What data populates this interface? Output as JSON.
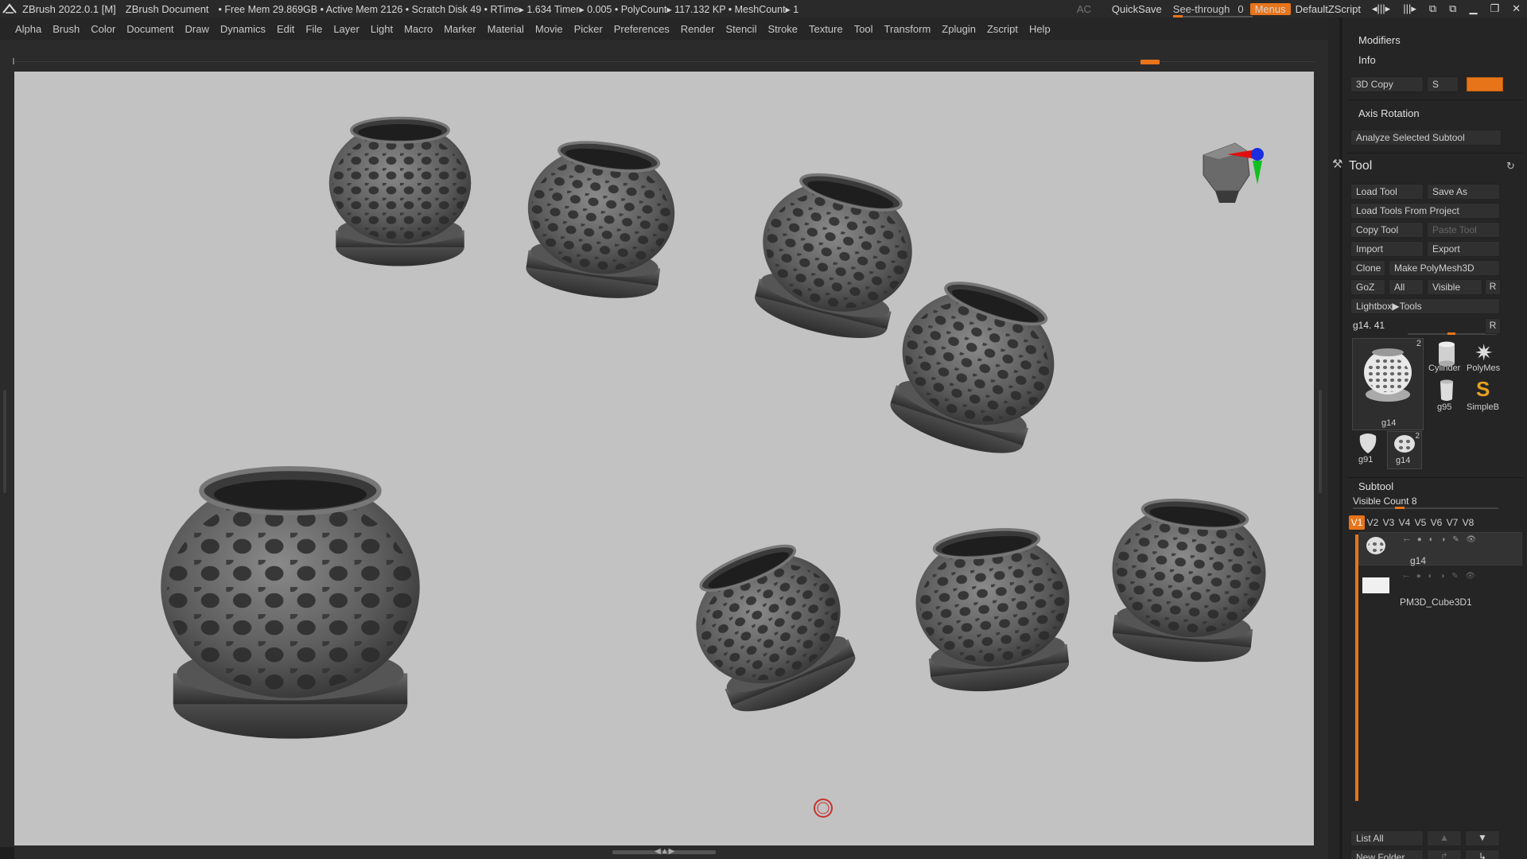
{
  "titlebar": {
    "app": "ZBrush 2022.0.1 [M]",
    "document": "ZBrush Document",
    "stats": "• Free Mem 29.869GB • Active Mem 2126 • Scratch Disk 49 •  RTime▸ 1.634 Timer▸ 0.005 • PolyCount▸ 117.132 KP  • MeshCount▸ 1",
    "ac": "AC",
    "quicksave": "QuickSave",
    "seethrough_label": "See-through",
    "seethrough_value": "0",
    "menus": "Menus",
    "script": "DefaultZScript"
  },
  "menubar": [
    "Alpha",
    "Brush",
    "Color",
    "Document",
    "Draw",
    "Dynamics",
    "Edit",
    "File",
    "Layer",
    "Light",
    "Macro",
    "Marker",
    "Material",
    "Movie",
    "Picker",
    "Preferences",
    "Render",
    "Stencil",
    "Stroke",
    "Texture",
    "Tool",
    "Transform",
    "Zplugin",
    "Zscript",
    "Help"
  ],
  "tray": {
    "modifiers": "Modifiers",
    "info": "Info",
    "copy3d": "3D Copy",
    "s_label": "S",
    "axis_rotation": "Axis Rotation",
    "analyze": "Analyze Selected Subtool",
    "tool_title": "Tool",
    "load_tool": "Load Tool",
    "save_as": "Save As",
    "load_from_project": "Load Tools From Project",
    "copy_tool": "Copy Tool",
    "paste_tool": "Paste Tool",
    "import": "Import",
    "export": "Export",
    "clone": "Clone",
    "make_polymesh": "Make PolyMesh3D",
    "goz": "GoZ",
    "all": "All",
    "visible": "Visible",
    "r": "R",
    "lightbox_tools": "Lightbox▶Tools",
    "tool_name": "g14. 41",
    "thumbs": [
      {
        "label": "g14",
        "count": "2"
      },
      {
        "label": "Cylinder"
      },
      {
        "label": "PolyMes"
      },
      {
        "label": "g95"
      },
      {
        "label": "SimpleB"
      },
      {
        "label": "g91"
      },
      {
        "label": "g14",
        "count": "2"
      }
    ],
    "subtool_title": "Subtool",
    "visible_count": "Visible Count 8",
    "vtabs": [
      "V1",
      "V2",
      "V3",
      "V4",
      "V5",
      "V6",
      "V7",
      "V8"
    ],
    "subtools": [
      "g14",
      "PM3D_Cube3D1"
    ],
    "list_all": "List All",
    "new_folder": "New Folder"
  }
}
